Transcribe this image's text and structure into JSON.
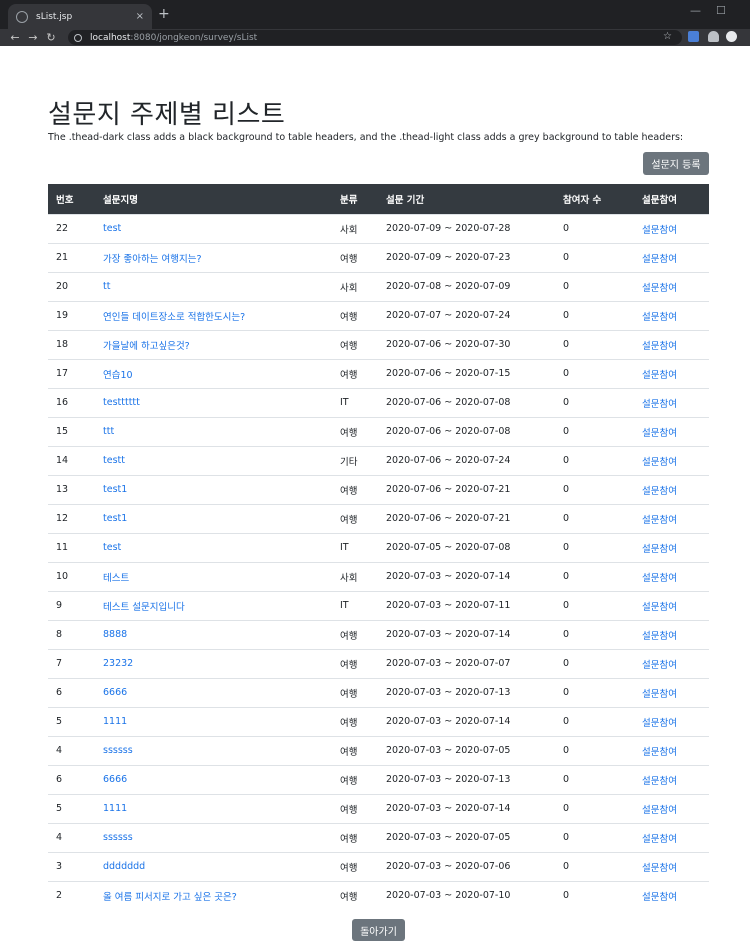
{
  "browser": {
    "tab_title": "sList.jsp",
    "tab_close": "×",
    "new_tab": "+",
    "url_host": "localhost",
    "url_path": ":8080/jongkeon/survey/sList",
    "win_min": "—",
    "win_max": "☐",
    "back": "←",
    "forward": "→",
    "reload": "↻",
    "star": "☆"
  },
  "page": {
    "title": "설문지 주제별 리스트",
    "description": "The .thead-dark class adds a black background to table headers, and the .thead-light class adds a grey background to table headers:",
    "register_button": "설문지 등록",
    "back_button": "돌아가기"
  },
  "table": {
    "headers": [
      "번호",
      "설문지명",
      "분류",
      "설문 기간",
      "참여자 수",
      "설문참여"
    ],
    "rows": [
      [
        "22",
        "test",
        "사회",
        "2020-07-09 ~ 2020-07-28",
        "0",
        "설문참여"
      ],
      [
        "21",
        "가장 좋아하는 여행지는?",
        "여행",
        "2020-07-09 ~ 2020-07-23",
        "0",
        "설문참여"
      ],
      [
        "20",
        "tt",
        "사회",
        "2020-07-08 ~ 2020-07-09",
        "0",
        "설문참여"
      ],
      [
        "19",
        "연인들 데이트장소로 적합한도시는?",
        "여행",
        "2020-07-07 ~ 2020-07-24",
        "0",
        "설문참여"
      ],
      [
        "18",
        "가을날에 하고싶은것?",
        "여행",
        "2020-07-06 ~ 2020-07-30",
        "0",
        "설문참여"
      ],
      [
        "17",
        "연습10",
        "여행",
        "2020-07-06 ~ 2020-07-15",
        "0",
        "설문참여"
      ],
      [
        "16",
        "testttttt",
        "IT",
        "2020-07-06 ~ 2020-07-08",
        "0",
        "설문참여"
      ],
      [
        "15",
        "ttt",
        "여행",
        "2020-07-06 ~ 2020-07-08",
        "0",
        "설문참여"
      ],
      [
        "14",
        "testt",
        "기타",
        "2020-07-06 ~ 2020-07-24",
        "0",
        "설문참여"
      ],
      [
        "13",
        "test1",
        "여행",
        "2020-07-06 ~ 2020-07-21",
        "0",
        "설문참여"
      ],
      [
        "12",
        "test1",
        "여행",
        "2020-07-06 ~ 2020-07-21",
        "0",
        "설문참여"
      ],
      [
        "11",
        "test",
        "IT",
        "2020-07-05 ~ 2020-07-08",
        "0",
        "설문참여"
      ],
      [
        "10",
        "테스트",
        "사회",
        "2020-07-03 ~ 2020-07-14",
        "0",
        "설문참여"
      ],
      [
        "9",
        "테스트 설문지입니다",
        "IT",
        "2020-07-03 ~ 2020-07-11",
        "0",
        "설문참여"
      ],
      [
        "8",
        "8888",
        "여행",
        "2020-07-03 ~ 2020-07-14",
        "0",
        "설문참여"
      ],
      [
        "7",
        "23232",
        "여행",
        "2020-07-03 ~ 2020-07-07",
        "0",
        "설문참여"
      ],
      [
        "6",
        "6666",
        "여행",
        "2020-07-03 ~ 2020-07-13",
        "0",
        "설문참여"
      ],
      [
        "5",
        "1111",
        "여행",
        "2020-07-03 ~ 2020-07-14",
        "0",
        "설문참여"
      ],
      [
        "4",
        "ssssss",
        "여행",
        "2020-07-03 ~ 2020-07-05",
        "0",
        "설문참여"
      ],
      [
        "6",
        "6666",
        "여행",
        "2020-07-03 ~ 2020-07-13",
        "0",
        "설문참여"
      ],
      [
        "5",
        "1111",
        "여행",
        "2020-07-03 ~ 2020-07-14",
        "0",
        "설문참여"
      ],
      [
        "4",
        "ssssss",
        "여행",
        "2020-07-03 ~ 2020-07-05",
        "0",
        "설문참여"
      ],
      [
        "3",
        "ddddddd",
        "여행",
        "2020-07-03 ~ 2020-07-06",
        "0",
        "설문참여"
      ],
      [
        "2",
        "올 여름 피서지로 가고 싶은 곳은?",
        "여행",
        "2020-07-03 ~ 2020-07-10",
        "0",
        "설문참여"
      ]
    ]
  },
  "colors": {
    "header_bg": "#343a40",
    "link": "#1a73e8",
    "button": "#6c757d"
  }
}
